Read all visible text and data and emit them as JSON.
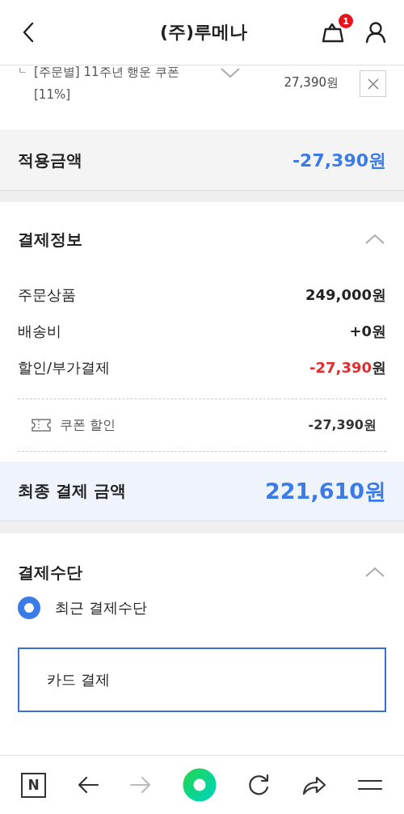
{
  "header": {
    "title": "(주)루메나",
    "cart_badge": "1"
  },
  "coupon": {
    "prefix": "ㄴ",
    "name": "[주문별] 11주년 행운 쿠폰 [11%]",
    "amount": "27,390원"
  },
  "applied": {
    "label": "적용금액",
    "value": "-27,390원"
  },
  "payment_info": {
    "title": "결제정보",
    "expanded": true,
    "rows": [
      {
        "label": "주문상품",
        "value": "249,000원",
        "kind": "plain"
      },
      {
        "label": "배송비",
        "value": "+0원",
        "kind": "plain"
      },
      {
        "label": "할인/부가결제",
        "value": "-27,390",
        "unit": "원",
        "kind": "discount"
      }
    ],
    "details": [
      {
        "label": "쿠폰 할인",
        "value": "-27,390원"
      }
    ]
  },
  "final": {
    "label": "최종 결제 금액",
    "value": "221,610원"
  },
  "payment_method": {
    "title": "결제수단",
    "expanded": true,
    "options": [
      {
        "label": "최근 결제수단",
        "selected": true
      }
    ],
    "card": {
      "label": "카드 결제"
    }
  },
  "nav": [
    {
      "kind": "home",
      "label": "N",
      "disabled": false
    },
    {
      "kind": "back",
      "disabled": false
    },
    {
      "kind": "forward",
      "disabled": true
    },
    {
      "kind": "green",
      "disabled": false
    },
    {
      "kind": "reload",
      "disabled": false
    },
    {
      "kind": "share",
      "disabled": false
    },
    {
      "kind": "menu",
      "disabled": false
    }
  ]
}
